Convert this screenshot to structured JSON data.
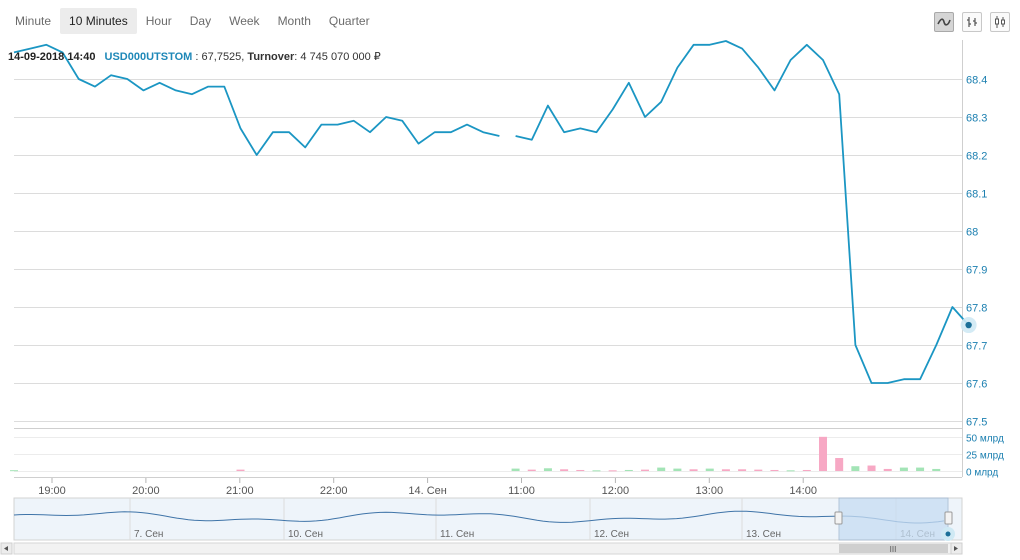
{
  "tabs": [
    {
      "label": "Minute"
    },
    {
      "label": "10 Minutes",
      "active": true
    },
    {
      "label": "Hour"
    },
    {
      "label": "Day"
    },
    {
      "label": "Week"
    },
    {
      "label": "Month"
    },
    {
      "label": "Quarter"
    }
  ],
  "tools": [
    {
      "name": "line-chart-icon",
      "active": true
    },
    {
      "name": "ohlc-chart-icon",
      "active": false
    },
    {
      "name": "candlestick-chart-icon",
      "active": false
    }
  ],
  "info": {
    "datetime": "14-09-2018 14:40",
    "ticker": "USD000UTSTOM",
    "value": ": 67,7525,",
    "turnover_label": "Turnover",
    "turnover_value": ": 4 745 070 000 ₽"
  },
  "colors": {
    "line": "#1b96c3",
    "vol_up": "#a3e4b6",
    "vol_down": "#f7a8c4",
    "grid": "#dcdcdc",
    "axis_text": "#1b7fb0",
    "nav_fill": "#eef4fa",
    "nav_selection": "#c7ddf3"
  },
  "chart_data": {
    "type": "line",
    "ylim": [
      67.5,
      68.5
    ],
    "yticks": [
      "67.5",
      "67.6",
      "67.7",
      "67.8",
      "67.9",
      "68",
      "68.1",
      "68.2",
      "68.3",
      "68.4"
    ],
    "xticks": [
      "19:00",
      "20:00",
      "21:00",
      "22:00",
      "14. Сен",
      "11:00",
      "12:00",
      "13:00",
      "14:00"
    ],
    "series": [
      {
        "segments": [
          [
            68.47,
            68.48,
            68.49,
            68.47,
            68.4,
            68.38,
            68.41,
            68.4,
            68.37,
            68.39,
            68.37,
            68.36,
            68.38,
            68.38,
            68.27,
            68.2,
            68.26,
            68.26,
            68.22,
            68.28,
            68.28,
            68.29,
            68.26,
            68.3,
            68.29,
            68.23,
            68.26,
            68.26,
            68.28,
            68.26,
            68.25
          ],
          [
            68.25,
            68.24,
            68.33,
            68.26,
            68.27,
            68.26,
            68.32,
            68.39,
            68.3,
            68.34,
            68.43,
            68.49,
            68.49,
            68.5,
            68.48,
            68.43,
            68.37,
            68.45,
            68.49,
            68.45,
            68.36,
            67.7,
            67.6,
            67.6,
            67.61,
            67.61,
            67.7,
            67.8,
            67.7525
          ]
        ]
      }
    ],
    "volume": {
      "yticks": [
        "0 млрд",
        "25 млрд",
        "50 млрд"
      ],
      "ylim": [
        0,
        60
      ],
      "bars": [
        {
          "i": 0,
          "v": 1.2,
          "up": true
        },
        {
          "i": 14,
          "v": 2.0,
          "up": false
        },
        {
          "i": 31,
          "v": 3.5,
          "up": true
        },
        {
          "i": 32,
          "v": 2.0,
          "up": false
        },
        {
          "i": 33,
          "v": 4.0,
          "up": true
        },
        {
          "i": 34,
          "v": 2.5,
          "up": false
        },
        {
          "i": 35,
          "v": 1.5,
          "up": false
        },
        {
          "i": 36,
          "v": 1.0,
          "up": true
        },
        {
          "i": 37,
          "v": 1.0,
          "up": false
        },
        {
          "i": 38,
          "v": 1.5,
          "up": true
        },
        {
          "i": 39,
          "v": 2.0,
          "up": false
        },
        {
          "i": 40,
          "v": 5.0,
          "up": true
        },
        {
          "i": 41,
          "v": 3.5,
          "up": true
        },
        {
          "i": 42,
          "v": 2.5,
          "up": false
        },
        {
          "i": 43,
          "v": 3.5,
          "up": true
        },
        {
          "i": 44,
          "v": 2.5,
          "up": false
        },
        {
          "i": 45,
          "v": 2.5,
          "up": false
        },
        {
          "i": 46,
          "v": 2.0,
          "up": false
        },
        {
          "i": 47,
          "v": 1.5,
          "up": false
        },
        {
          "i": 48,
          "v": 1.0,
          "up": true
        },
        {
          "i": 49,
          "v": 1.5,
          "up": false
        },
        {
          "i": 50,
          "v": 50.0,
          "up": false
        },
        {
          "i": 51,
          "v": 19.0,
          "up": false
        },
        {
          "i": 52,
          "v": 7.0,
          "up": true
        },
        {
          "i": 53,
          "v": 8.0,
          "up": false
        },
        {
          "i": 54,
          "v": 3.0,
          "up": false
        },
        {
          "i": 55,
          "v": 5.0,
          "up": true
        },
        {
          "i": 56,
          "v": 5.0,
          "up": true
        },
        {
          "i": 57,
          "v": 3.0,
          "up": true
        }
      ]
    },
    "navigator": {
      "days": [
        "7. Сен",
        "10. Сен",
        "11. Сен",
        "12. Сен",
        "13. Сен",
        "14. Сен"
      ],
      "scroll_label": "III"
    }
  }
}
